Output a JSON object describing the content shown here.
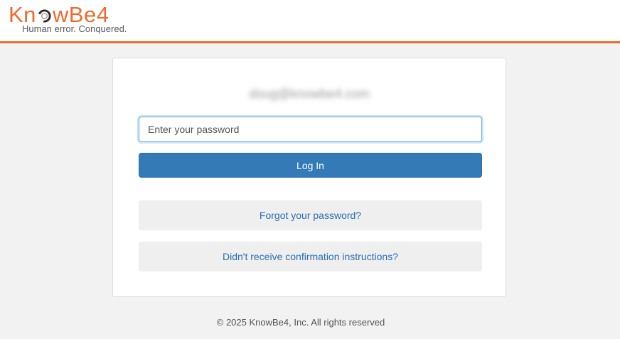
{
  "header": {
    "logo": {
      "brand_prefix": "Kn",
      "brand_suffix": "wBe4",
      "tagline": "Human error. Conquered."
    },
    "accent_color": "#ef6b2c"
  },
  "login_card": {
    "email": "doug@knowbe4.com",
    "password_field": {
      "value": "",
      "placeholder": "Enter your password"
    },
    "login_button_label": "Log In",
    "forgot_password_label": "Forgot your password?",
    "confirmation_label": "Didn't receive confirmation instructions?"
  },
  "colors": {
    "primary_button": "#337ab7",
    "link": "#2a6fb0"
  },
  "footer": {
    "copyright": "© 2025 KnowBe4, Inc. All rights reserved"
  }
}
